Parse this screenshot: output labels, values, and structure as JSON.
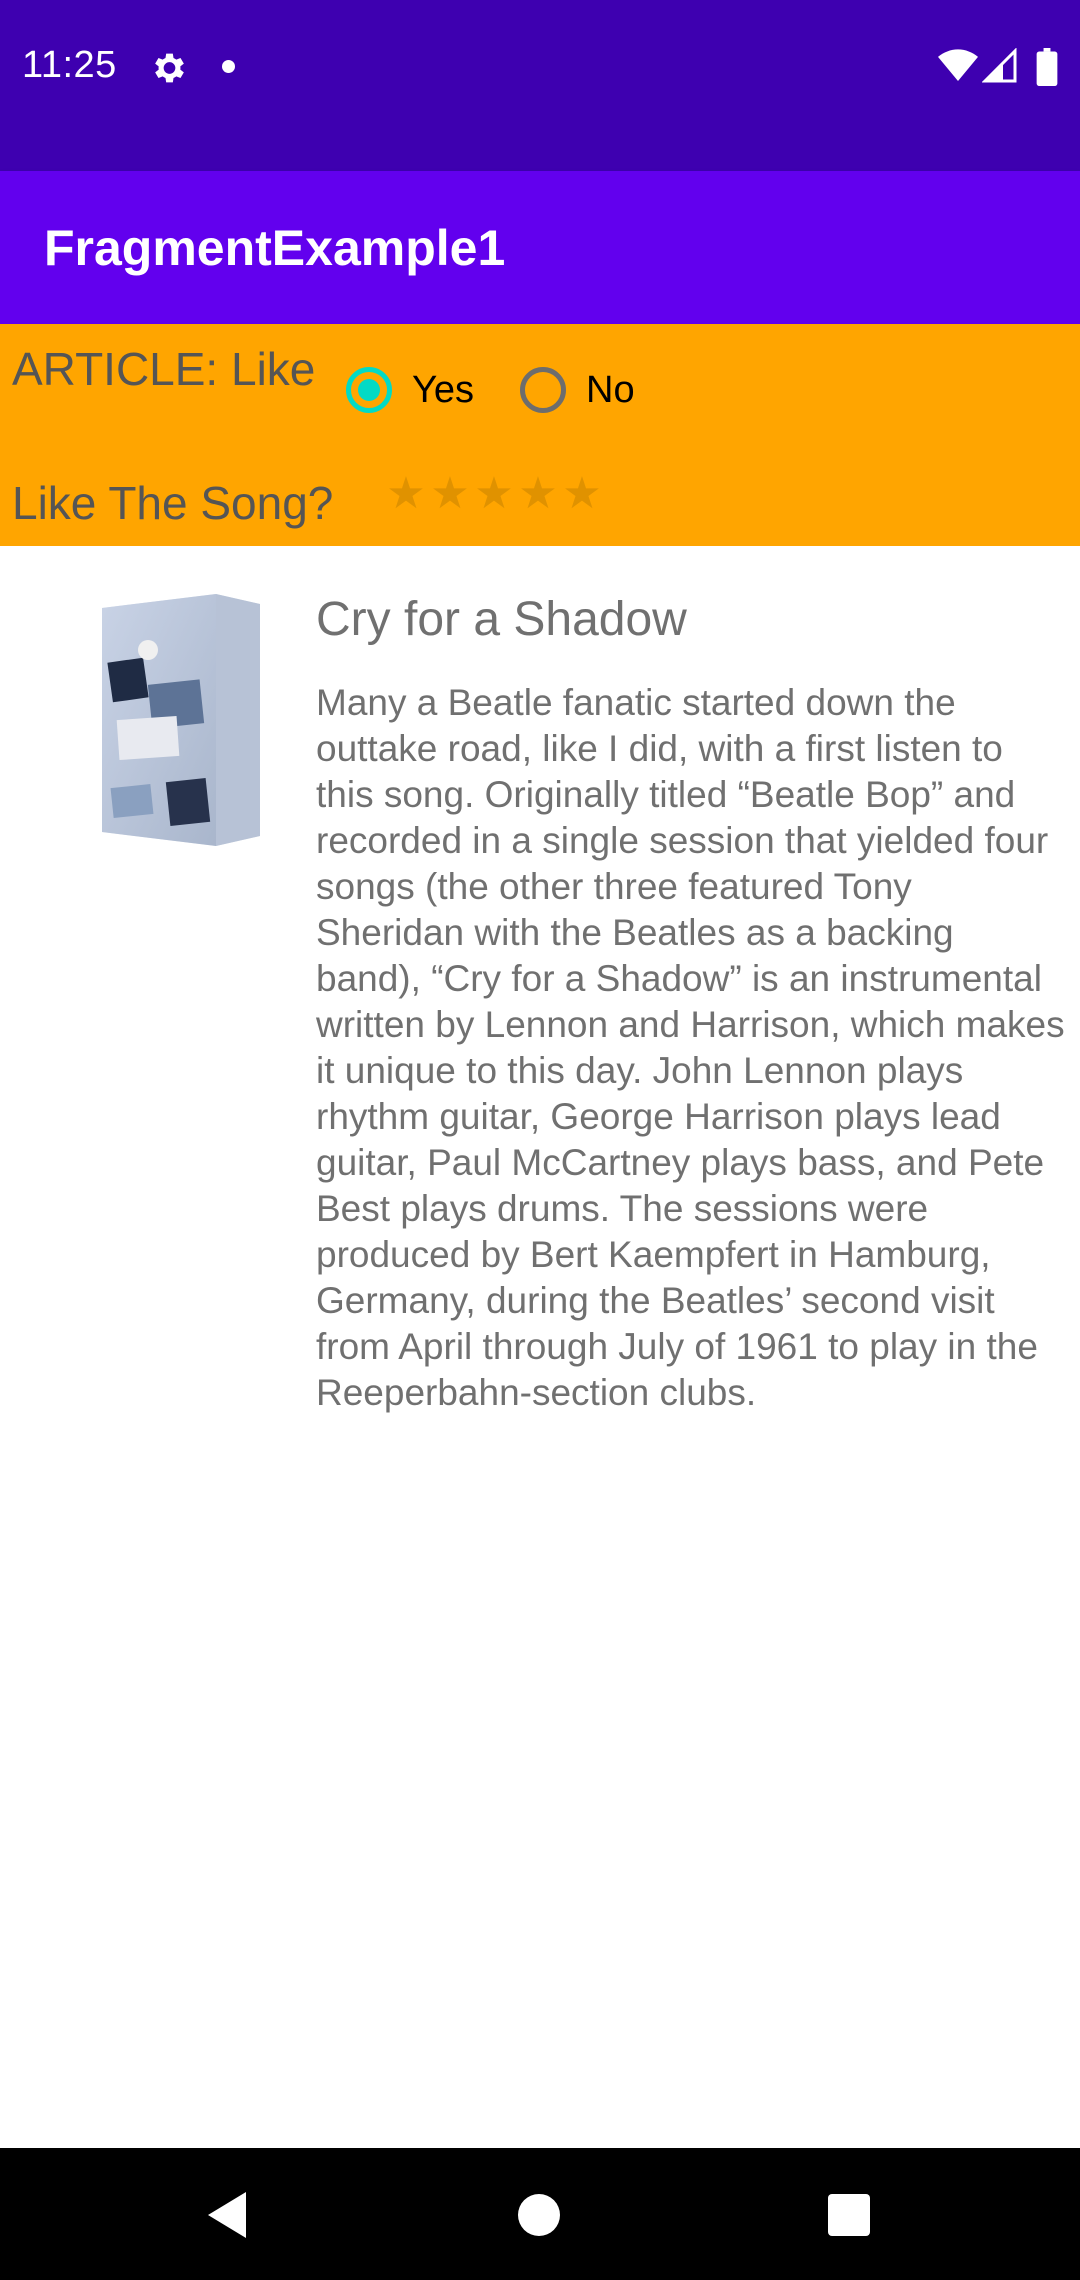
{
  "status_bar": {
    "time": "11:25",
    "background": "#3e00b0"
  },
  "app_bar": {
    "title": "FragmentExample1",
    "background": "#6200ee"
  },
  "top_fragment": {
    "background": "#ffa500",
    "article_label": "ARTICLE: Like",
    "radio_options": [
      {
        "label": "Yes",
        "checked": true
      },
      {
        "label": "No",
        "checked": false
      }
    ],
    "song_question": "Like The Song?",
    "rating": {
      "value": 0,
      "max": 5
    }
  },
  "article": {
    "album_art_icon": "beatles-anthology-box-image",
    "title": "Cry for a Shadow",
    "body": "Many a Beatle fanatic started down the outtake road, like I did, with a first listen to this song. Originally titled “Beatle Bop” and recorded in a single session that yielded four songs (the other three featured Tony Sheridan with the Beatles as a backing band), “Cry for a Shadow” is an instrumental written by Lennon and Harrison, which makes it unique to this day. John Lennon plays rhythm guitar, George Harrison plays lead guitar, Paul McCartney plays bass, and Pete Best plays drums. The sessions were produced by Bert Kaempfert in Hamburg, Germany, during the Beatles’ second visit from April through July of 1961 to play in the Reeperbahn-section clubs."
  },
  "icons": {
    "settings": "gear-icon",
    "wifi": "wifi-icon",
    "signal": "signal-icon",
    "battery": "battery-icon",
    "back": "back-icon",
    "home": "home-icon",
    "recents": "recents-icon"
  },
  "colors": {
    "radio_checked": "#03dac5",
    "star": "#e09200",
    "body_text": "#707070"
  }
}
